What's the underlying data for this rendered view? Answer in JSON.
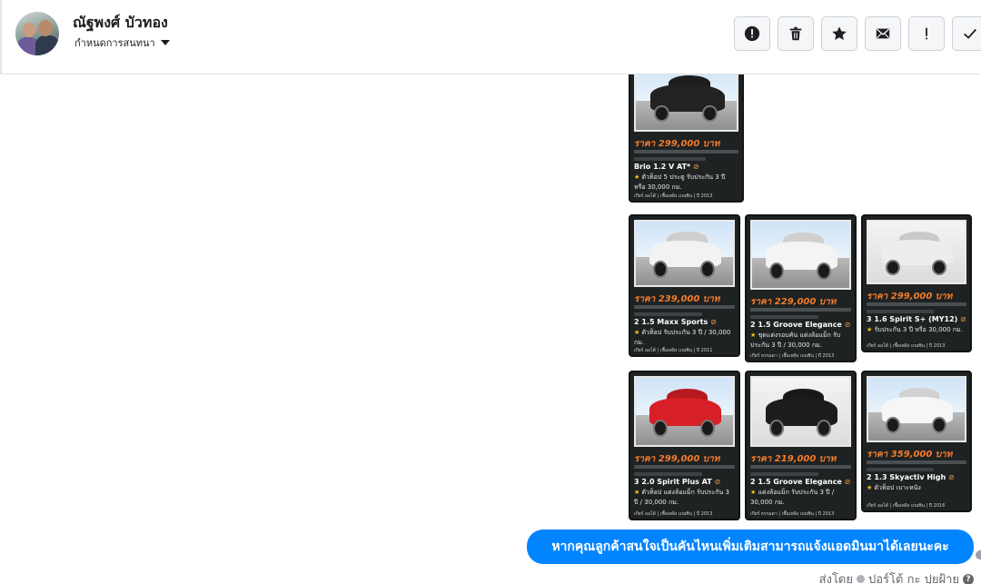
{
  "header": {
    "contact_name": "ณัฐพงศ์ บัวทอง",
    "subtitle": "กำหนดการสนทนา",
    "actions": [
      {
        "name": "spam",
        "icon": "alert-circle-icon"
      },
      {
        "name": "delete",
        "icon": "trash-icon"
      },
      {
        "name": "star",
        "icon": "star-icon"
      },
      {
        "name": "mark-unread",
        "icon": "envelope-icon"
      },
      {
        "name": "important",
        "icon": "exclamation-icon"
      },
      {
        "name": "done",
        "icon": "check-icon"
      }
    ]
  },
  "cards": [
    {
      "price": "ราคา 299,000 บาท",
      "model": "Brio 1.2 V AT*",
      "desc": "ตัวท็อป 5 ประตู รับประกัน 3 ปี หรือ 30,000 กม.",
      "foot": "เกียร์ ออโต้ | เชื้อเพลิง เบนซิน | ปี 2013",
      "color": "#222222"
    },
    {
      "price": "ราคา 239,000 บาท",
      "model": "2 1.5 Maxx Sports",
      "desc": "ตัวท็อป รับประกัน 3 ปี / 30,000 กม.",
      "foot": "เกียร์ ออโต้ | เชื้อเพลิง เบนซิน | ปี 2011",
      "color": "#f2f2f2"
    },
    {
      "price": "ราคา 229,000 บาท",
      "model": "2 1.5 Groove Elegance",
      "desc": "ชุดแต่งรอบคัน แต่งล้อแม็ก รับประกัน 3 ปี / 30,000 กม.",
      "foot": "เกียร์ ธรรมดา | เชื้อเพลิง เบนซิน | ปี 2013",
      "color": "#f4f4f4"
    },
    {
      "price": "ราคา 299,000 บาท",
      "model": "3 1.6 Spirit S+ (MY12)",
      "desc": "รับประกัน 3 ปี หรือ 30,000 กม.",
      "foot": "เกียร์ ออโต้ | เชื้อเพลิง เบนซิน | ปี 2013",
      "color": "#ededed"
    },
    {
      "price": "ราคา 299,000 บาท",
      "model": "3 2.0 Spirit Plus AT",
      "desc": "ตัวท็อป แต่งล้อแม็ก รับประกัน 3 ปี / 30,000 กม.",
      "foot": "เกียร์ ออโต้ | เชื้อเพลิง เบนซิน | ปี 2013",
      "color": "#d61f26"
    },
    {
      "price": "ราคา 219,000 บาท",
      "model": "2 1.5 Groove Elegance",
      "desc": "แต่งล้อแม็ก รับประกัน 3 ปี / 30,000 กม.",
      "foot": "เกียร์ ธรรมดา | เชื้อเพลิง เบนซิน | ปี 2013",
      "color": "#1c1c1c"
    },
    {
      "price": "ราคา 359,000 บาท",
      "model": "2 1.3 Skyactiv High",
      "desc": "ตัวท็อป เบาะหนัง",
      "foot": "เกียร์ ออโต้ | เชื้อเพลิง เบนซิน | ปี 2016",
      "color": "#f6f6f6"
    }
  ],
  "message": {
    "text": "หากคุณลูกค้าสนใจเป็นคันไหนเพิ่มเติมสามารถแจ้งแอดมินมาได้เลยนะคะ",
    "sent_by_label": "ส่งโดย",
    "sender": "ปอร์โต้ กะ ปุยฝ้าย",
    "help_icon": "?"
  },
  "colors": {
    "bubble": "#0084ff",
    "price": "#f27c2c",
    "card_bg": "#1f2223"
  }
}
